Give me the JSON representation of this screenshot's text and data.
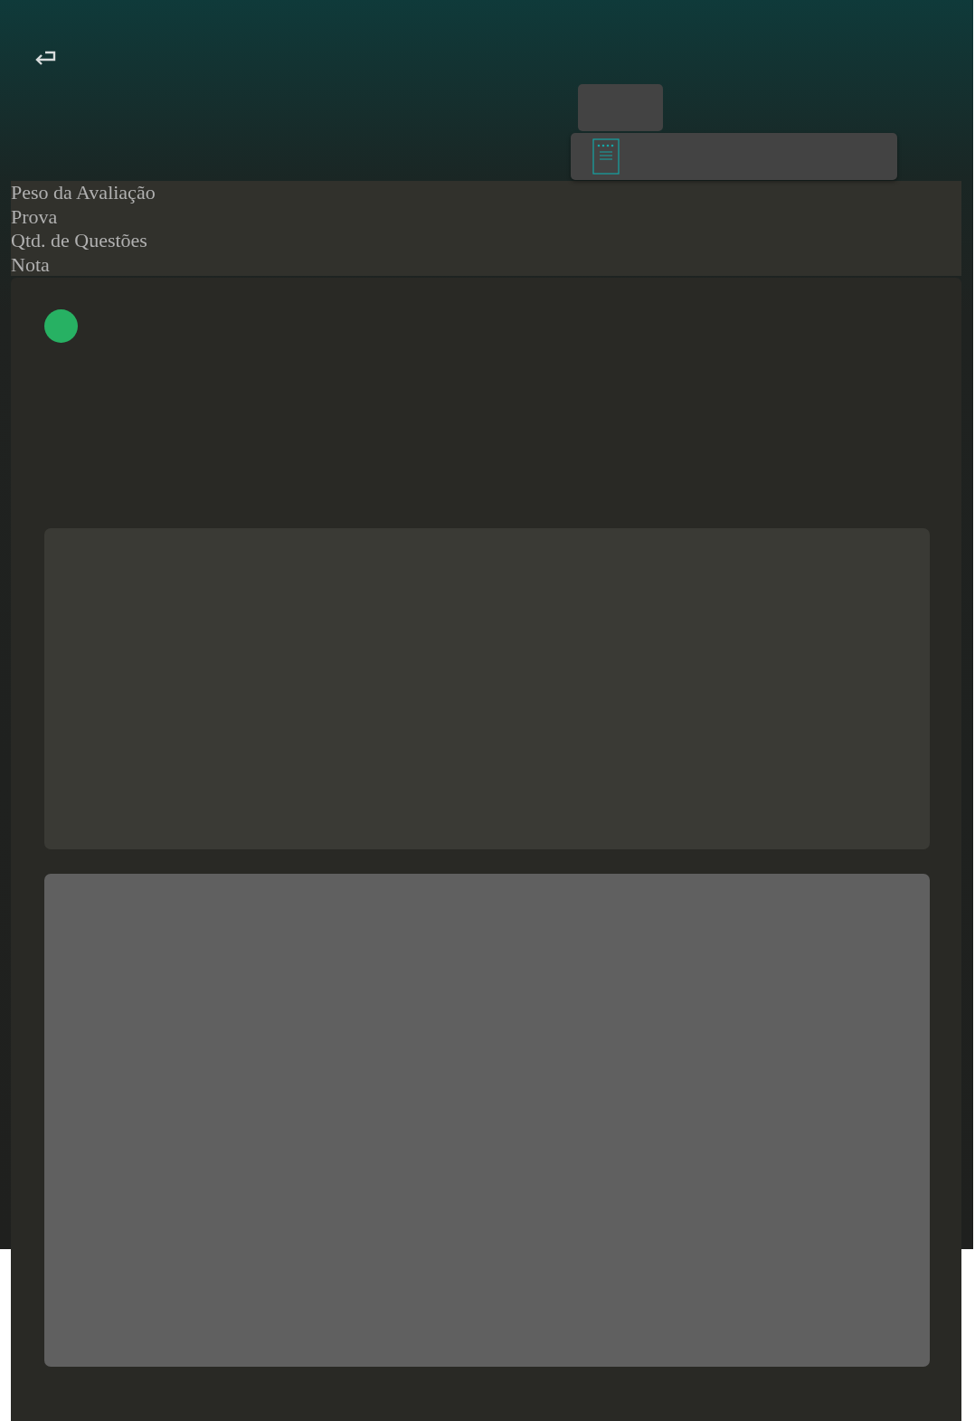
{
  "labels": [
    "Peso da Avaliação",
    "Prova",
    "Qtd. de Questões",
    "Nota"
  ]
}
